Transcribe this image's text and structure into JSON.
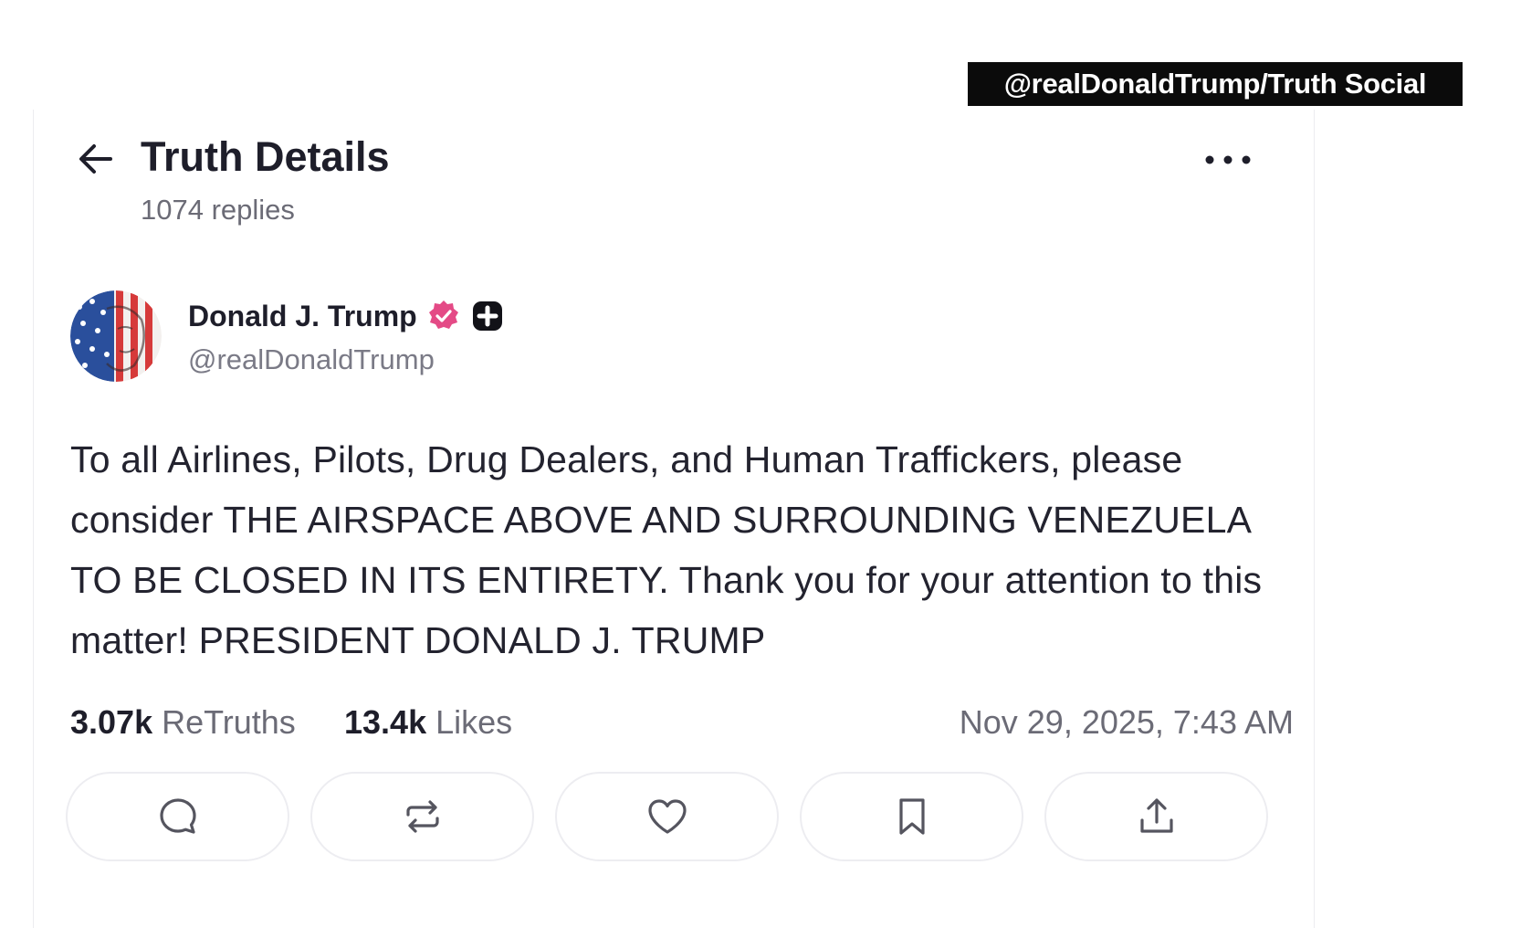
{
  "source_tag": "@realDonaldTrump/Truth Social",
  "header": {
    "title": "Truth Details",
    "replies": "1074 replies",
    "back_icon": "arrow-left-icon",
    "more_icon": "more-horizontal-icon"
  },
  "author": {
    "name": "Donald J. Trump",
    "handle": "@realDonaldTrump",
    "verified_icon": "verified-badge-icon",
    "plus_icon": "plus-badge-icon",
    "verified_color": "#e44a86"
  },
  "post": {
    "text": "To all Airlines, Pilots, Drug Dealers, and Human Traffickers, please consider THE AIRSPACE ABOVE AND SURROUNDING VENEZUELA TO BE CLOSED IN ITS ENTIRETY. Thank you for your attention to this matter! PRESIDENT DONALD J. TRUMP"
  },
  "stats": {
    "retruths_count": "3.07k",
    "retruths_label": "ReTruths",
    "likes_count": "13.4k",
    "likes_label": "Likes",
    "timestamp": "Nov 29, 2025, 7:43 AM"
  },
  "actions": [
    {
      "name": "reply",
      "icon": "comment-icon"
    },
    {
      "name": "retruth",
      "icon": "repost-icon"
    },
    {
      "name": "like",
      "icon": "heart-icon"
    },
    {
      "name": "bookmark",
      "icon": "bookmark-icon"
    },
    {
      "name": "share",
      "icon": "share-upload-icon"
    }
  ]
}
